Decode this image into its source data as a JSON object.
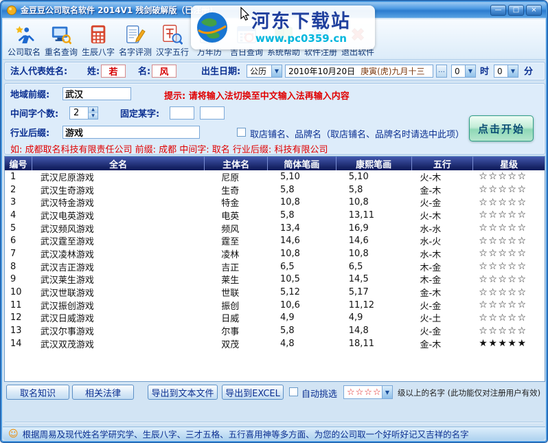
{
  "window": {
    "title": "金豆豆公司取名软件  2014V1 残剑破解版（已注册）",
    "minimize": "—",
    "maximize": "□",
    "close": "×"
  },
  "watermark": {
    "site_name": "河东下载站",
    "site_url": "www.pc0359.cn"
  },
  "toolbar": {
    "items": [
      {
        "label": "公司取名"
      },
      {
        "label": "重名查询"
      },
      {
        "label": "生辰八字"
      },
      {
        "label": "名字评测"
      },
      {
        "label": "汉字五行"
      },
      {
        "label": "万年历"
      },
      {
        "label": "吉日查询"
      },
      {
        "label": "系统帮助"
      },
      {
        "label": "软件注册"
      },
      {
        "label": "退出软件"
      }
    ]
  },
  "form": {
    "legal_name_label": "法人代表姓名:",
    "surname_label": "姓:",
    "surname": "若",
    "given_label": "名:",
    "given_name": "风",
    "birth_label": "出生日期:",
    "calendar_type": "公历",
    "birth_date": "2010年10月20日",
    "lunar_date": "庚寅(虎)九月十三",
    "more_button": "…",
    "hour": "0",
    "hour_label": "时",
    "minute": "0",
    "minute_label": "分"
  },
  "naming": {
    "region_label": "地域前缀:",
    "region": "武汉",
    "hint": "提示: 请将输入法切换至中文输入法再输入内容",
    "middle_count_label": "中间字个数:",
    "middle_count": "2",
    "fixed_char_label": "固定某字:",
    "fixed_char_1": "",
    "fixed_char_2": "",
    "industry_label": "行业后缀:",
    "industry": "游戏",
    "shop_option": "取店铺名、品牌名（取店铺名、品牌名时请选中此项）",
    "start_button": "点击开始",
    "example": "如: 成都取名科技有限责任公司  前缀: 成都  中间字: 取名  行业后缀: 科技有限公司"
  },
  "table": {
    "headers": [
      "编号",
      "全名",
      "主体名",
      "简体笔画",
      "康熙笔画",
      "五行",
      "星级"
    ],
    "rows": [
      {
        "no": "1",
        "full_name": "武汉尼原游戏",
        "main_name": "尼原",
        "simplified": "5,10",
        "kangxi": "5,10",
        "five_elements": "火-木",
        "stars": "☆☆☆☆☆"
      },
      {
        "no": "2",
        "full_name": "武汉生奇游戏",
        "main_name": "生奇",
        "simplified": "5,8",
        "kangxi": "5,8",
        "five_elements": "金-木",
        "stars": "☆☆☆☆☆"
      },
      {
        "no": "3",
        "full_name": "武汉特金游戏",
        "main_name": "特金",
        "simplified": "10,8",
        "kangxi": "10,8",
        "five_elements": "火-金",
        "stars": "☆☆☆☆☆"
      },
      {
        "no": "4",
        "full_name": "武汉电英游戏",
        "main_name": "电英",
        "simplified": "5,8",
        "kangxi": "13,11",
        "five_elements": "火-木",
        "stars": "☆☆☆☆☆"
      },
      {
        "no": "5",
        "full_name": "武汉频风游戏",
        "main_name": "频风",
        "simplified": "13,4",
        "kangxi": "16,9",
        "five_elements": "水-水",
        "stars": "☆☆☆☆☆"
      },
      {
        "no": "6",
        "full_name": "武汉霆至游戏",
        "main_name": "霆至",
        "simplified": "14,6",
        "kangxi": "14,6",
        "five_elements": "水-火",
        "stars": "☆☆☆☆☆"
      },
      {
        "no": "7",
        "full_name": "武汉凌林游戏",
        "main_name": "凌林",
        "simplified": "10,8",
        "kangxi": "10,8",
        "five_elements": "水-木",
        "stars": "☆☆☆☆☆"
      },
      {
        "no": "8",
        "full_name": "武汉吉正游戏",
        "main_name": "吉正",
        "simplified": "6,5",
        "kangxi": "6,5",
        "five_elements": "木-金",
        "stars": "☆☆☆☆☆"
      },
      {
        "no": "9",
        "full_name": "武汉莱生游戏",
        "main_name": "莱生",
        "simplified": "10,5",
        "kangxi": "14,5",
        "five_elements": "木-金",
        "stars": "☆☆☆☆☆"
      },
      {
        "no": "10",
        "full_name": "武汉世联游戏",
        "main_name": "世联",
        "simplified": "5,12",
        "kangxi": "5,17",
        "five_elements": "金-木",
        "stars": "☆☆☆☆☆"
      },
      {
        "no": "11",
        "full_name": "武汉振创游戏",
        "main_name": "振创",
        "simplified": "10,6",
        "kangxi": "11,12",
        "five_elements": "火-金",
        "stars": "☆☆☆☆☆"
      },
      {
        "no": "12",
        "full_name": "武汉日威游戏",
        "main_name": "日威",
        "simplified": "4,9",
        "kangxi": "4,9",
        "five_elements": "火-土",
        "stars": "☆☆☆☆☆"
      },
      {
        "no": "13",
        "full_name": "武汉尔事游戏",
        "main_name": "尔事",
        "simplified": "5,8",
        "kangxi": "14,8",
        "five_elements": "火-金",
        "stars": "☆☆☆☆☆"
      },
      {
        "no": "14",
        "full_name": "武汉双茂游戏",
        "main_name": "双茂",
        "simplified": "4,8",
        "kangxi": "18,11",
        "five_elements": "金-木",
        "stars": "★★★★★"
      }
    ]
  },
  "footer": {
    "knowledge_button": "取名知识",
    "law_button": "相关法律",
    "export_txt_button": "导出到文本文件",
    "export_excel_button": "导出到EXCEL",
    "auto_pick_label": "自动挑选",
    "star_filter": "☆☆☆☆",
    "filter_note": "级以上的名字 (此功能仅对注册用户有效)"
  },
  "statusbar": {
    "smiley": "☺",
    "text": "根据周易及现代姓名学研究学、生辰八字、三才五格、五行喜用神等多方面、为您的公司取一个好听好记又吉祥的名字"
  },
  "colors": {
    "accent_red": "#e00000",
    "label_navy": "#0b2f91",
    "table_header_top": "#4358ae",
    "table_header_bottom": "#131f60",
    "start_button_green": "#8fd8b6",
    "watermark_blue": "#20409e",
    "watermark_cyan": "#00b6dd"
  }
}
